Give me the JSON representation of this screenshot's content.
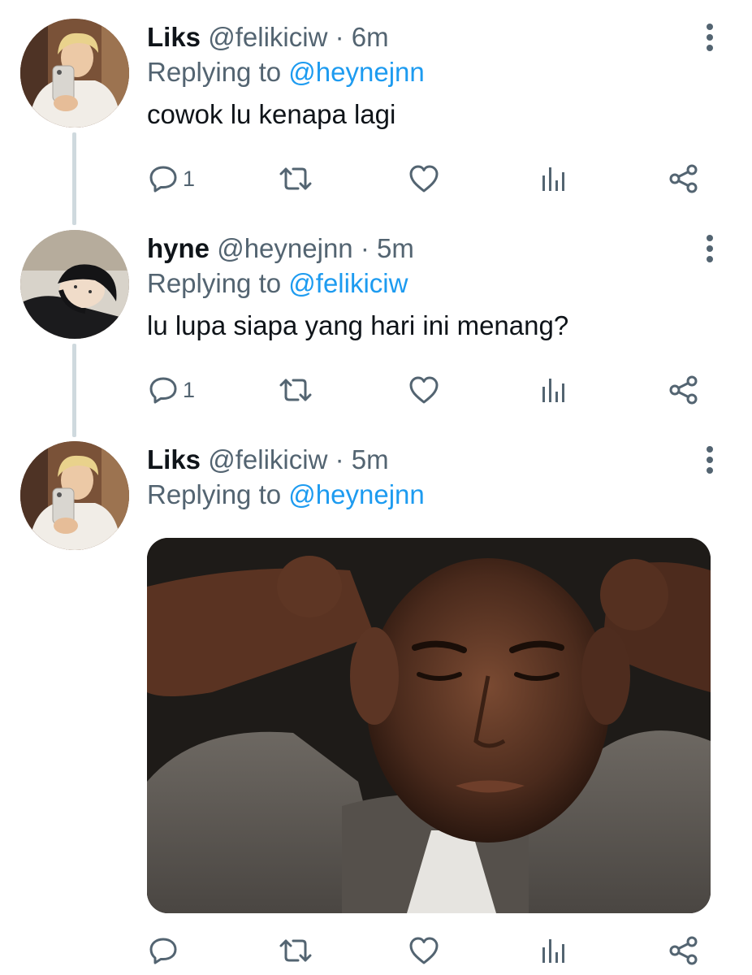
{
  "tweets": [
    {
      "display_name": "Liks",
      "handle": "@felikiciw",
      "separator": "·",
      "time": "6m",
      "replying_prefix": "Replying to",
      "replying_to": "@heynejnn",
      "text": "cowok lu kenapa lagi",
      "reply_count": "1",
      "avatar": "avatar-liks"
    },
    {
      "display_name": "hyne",
      "handle": "@heynejnn",
      "separator": "·",
      "time": "5m",
      "replying_prefix": "Replying to",
      "replying_to": "@felikiciw",
      "text": "lu lupa siapa yang hari ini menang?",
      "reply_count": "1",
      "avatar": "avatar-hyne"
    },
    {
      "display_name": "Liks",
      "handle": "@felikiciw",
      "separator": "·",
      "time": "5m",
      "replying_prefix": "Replying to",
      "replying_to": "@heynejnn",
      "text": "",
      "reply_count": "",
      "avatar": "avatar-liks",
      "media": "photo-man-covering-ears"
    }
  ],
  "icons": {
    "reply": "reply-icon",
    "retweet": "retweet-icon",
    "like": "heart-icon",
    "views": "analytics-icon",
    "share": "share-icon",
    "more": "more-vertical-icon"
  },
  "colors": {
    "text": "#0f1419",
    "secondary": "#536471",
    "link": "#1d9bf0",
    "thread_line": "#cfd9de"
  }
}
